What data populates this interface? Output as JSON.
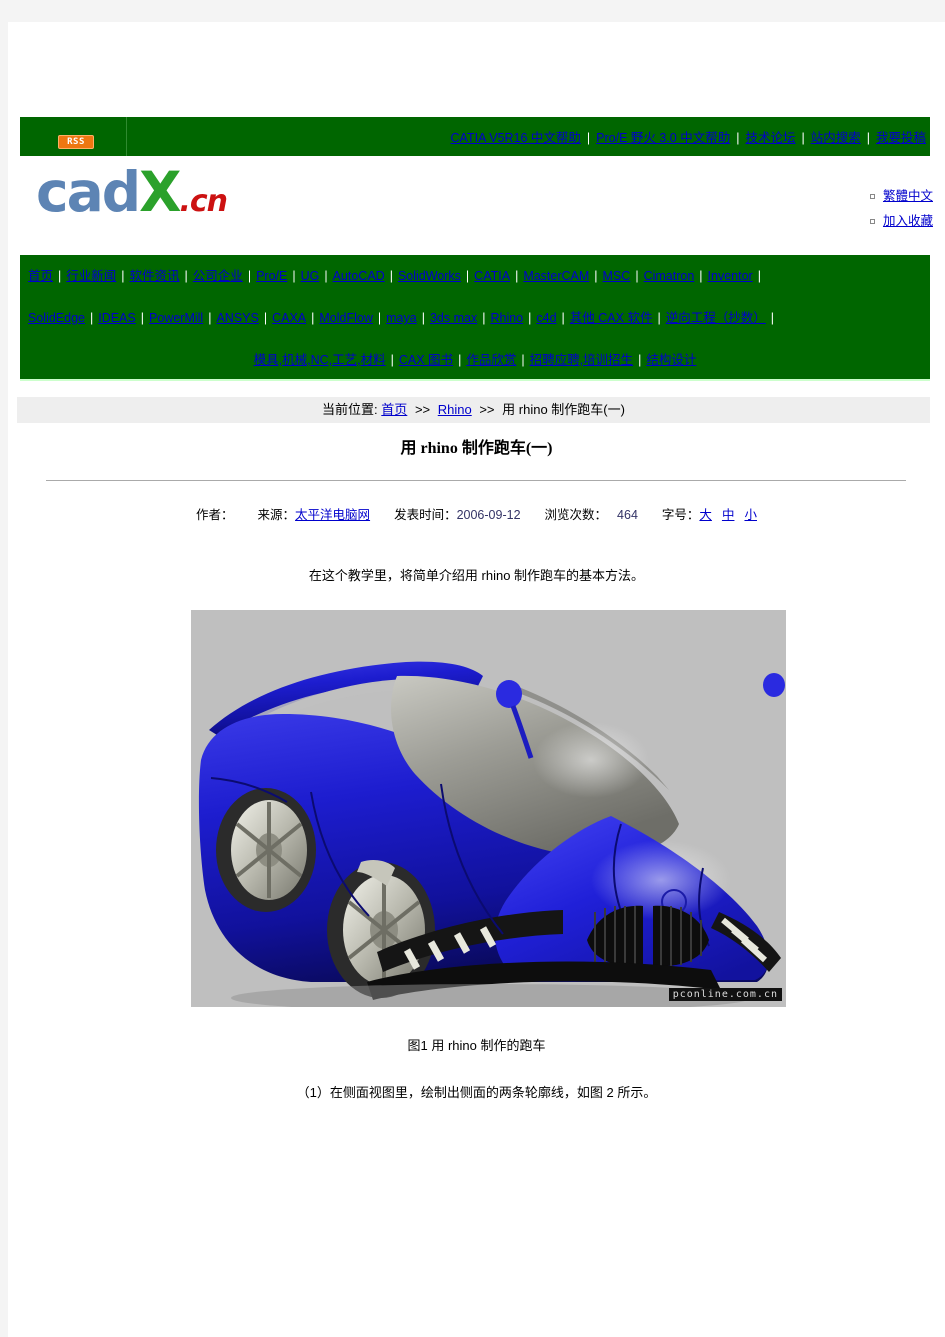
{
  "site": {
    "logo": {
      "part1": "cad",
      "part2": "X",
      "part3": ".cn"
    },
    "rss_label": "RSS"
  },
  "topbar": {
    "links": [
      "CATIA V5R16 中文帮助",
      "Pro/E 野火 3.0 中文帮助",
      "技术论坛",
      "站内搜索",
      "我要投稿"
    ],
    "separator": "|"
  },
  "sidelinks": [
    "繁體中文",
    "加入收藏"
  ],
  "mainnav": {
    "separator": "|",
    "row1": [
      "首页",
      "行业新闻",
      "软件资讯",
      "公司企业",
      "Pro/E",
      "UG",
      "AutoCAD",
      "SolidWorks",
      "CATIA",
      "MasterCAM",
      "MSC",
      "Cimatron",
      "Inventor"
    ],
    "row2": [
      "SolidEdge",
      "IDEAS",
      "PowerMill",
      "ANSYS",
      "CAXA",
      "MoldFlow",
      "maya",
      "3ds max",
      "Rhino",
      "c4d",
      "其他 CAX 软件",
      "逆向工程（抄数）"
    ],
    "row3": [
      "模具,机械,NC,工艺,材料",
      "CAX 图书",
      "作品欣赏",
      "招聘应聘,培训招生",
      "结构设计"
    ]
  },
  "breadcrumb": {
    "label": "当前位置:",
    "home": "首页",
    "arrow": ">>",
    "category": "Rhino",
    "current": "用 rhino 制作跑车(一)"
  },
  "article": {
    "title": "用 rhino 制作跑车(一)",
    "meta": {
      "author_label": "作者：",
      "author_value": "",
      "source_label": "来源：",
      "source_value": "太平洋电脑网",
      "date_label": "发表时间：",
      "date_value": "2006-09-12",
      "views_label": "浏览次数：",
      "views_value": "464",
      "fontsize_label": "字号：",
      "fontsize_large": "大",
      "fontsize_medium": "中",
      "fontsize_small": "小"
    },
    "paragraph1": "在这个教学里，将简单介绍用 rhino 制作跑车的基本方法。",
    "figure_caption": "图1  用 rhino 制作的跑车",
    "paragraph2": "（1）在侧面视图里，绘制出侧面的两条轮廓线，如图 2 所示。",
    "figure": {
      "alt": "用 rhino 制作的蓝色跑车三维渲染图",
      "watermark": "pconline.com.cn",
      "background_color": "#bfbfbf",
      "body_color": "#1a1acc",
      "canopy_color": "#9a9a96"
    }
  },
  "colors": {
    "nav_green": "#006600",
    "link_blue": "#0000cc",
    "breadcrumb_bg": "#eeeeee",
    "page_bg": "#f4f4f4",
    "rss_orange": "#ee7711"
  }
}
